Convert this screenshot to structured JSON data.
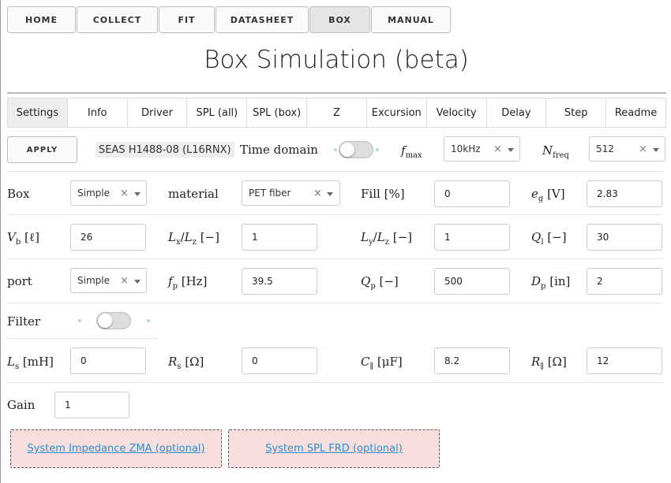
{
  "nav": [
    "HOME",
    "COLLECT",
    "FIT",
    "DATASHEET",
    "BOX",
    "MANUAL"
  ],
  "title": "Box Simulation (beta)",
  "tabs": [
    "Settings",
    "Info",
    "Driver",
    "SPL (all)",
    "SPL (box)",
    "Z",
    "Excursion",
    "Velocity",
    "Delay",
    "Step",
    "Readme"
  ],
  "active_tab": "Settings",
  "toolbar": {
    "apply_label": "APPLY",
    "driver_name": "SEAS H1488-08 (L16RNX)",
    "time_domain_label": "Time domain",
    "time_domain_on": false,
    "fmax_value": "10kHz",
    "nfreq_value": "512"
  },
  "box_row": {
    "box_type": "Simple",
    "material_label": "material",
    "material": "PET fiber",
    "fill_label": "Fill",
    "fill": "0",
    "eg": "2.83",
    "box_label": "Box"
  },
  "vol_row": {
    "vb": "26",
    "lxlz": "1",
    "lylz": "1",
    "ql": "30"
  },
  "port_row": {
    "port_label": "port",
    "port_type": "Simple",
    "fp": "39.5",
    "qp": "500",
    "dp": "2"
  },
  "filter": {
    "label": "Filter",
    "on": false
  },
  "filter_row": {
    "ls": "0",
    "rs": "0",
    "cp": "8.2",
    "rp": "12"
  },
  "gain": {
    "label": "Gain",
    "value": "1"
  },
  "drop": {
    "zma": "System Impedance ZMA (optional)",
    "frd": "System SPL FRD (optional)"
  },
  "clear_mark": "×",
  "units": {
    "percent": "[%]",
    "volt": "[V]",
    "litre": "[ℓ]",
    "dimensionless": "[−]",
    "hz": "[Hz]",
    "inch": "[in]",
    "mh": "[mH]",
    "ohm": "[Ω]",
    "uf": "[μF]"
  },
  "symbols": {
    "fmax_main": "f",
    "fmax_sub": "max",
    "nfreq_main": "N",
    "nfreq_sub": "freq",
    "eg_main": "e",
    "eg_sub": "g",
    "vb_main": "V",
    "vb_sub": "b",
    "lx_main": "L",
    "lx_sub": "x",
    "ly_main": "L",
    "ly_sub": "y",
    "lz_main": "L",
    "lz_sub": "z",
    "ql_main": "Q",
    "ql_sub": "l",
    "fp_main": "f",
    "fp_sub": "p",
    "qp_main": "Q",
    "qp_sub": "p",
    "dp_main": "D",
    "dp_sub": "p",
    "ls_main": "L",
    "ls_sub": "s",
    "rs_main": "R",
    "rs_sub": "s",
    "cp_main": "C",
    "cp_sub": "∥",
    "rp_main": "R",
    "rp_sub": "∥",
    "mu": "μ",
    "slash": "/"
  }
}
